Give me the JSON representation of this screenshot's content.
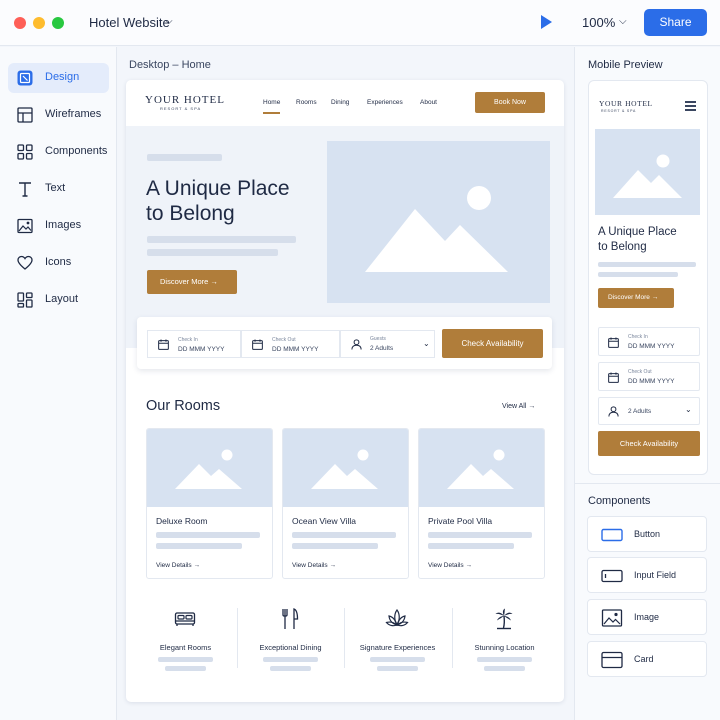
{
  "titlebar": {
    "app_title": "Hotel Website",
    "zoom": "100%",
    "share_label": "Share"
  },
  "sidebar": {
    "items": [
      {
        "label": "Design",
        "icon": "design-icon"
      },
      {
        "label": "Wireframes",
        "icon": "wireframes-icon"
      },
      {
        "label": "Components",
        "icon": "components-icon"
      },
      {
        "label": "Text",
        "icon": "text-icon"
      },
      {
        "label": "Images",
        "icon": "images-icon"
      },
      {
        "label": "Icons",
        "icon": "heart-icon"
      },
      {
        "label": "Layout",
        "icon": "layout-icon"
      }
    ],
    "active": "Design"
  },
  "canvas": {
    "label": "Desktop – Home",
    "header": {
      "logo": "YOUR HOTEL",
      "logo_sub": "RESORT & SPA",
      "nav": [
        "Home",
        "Rooms",
        "Dining",
        "Experiences",
        "About"
      ],
      "active_nav": "Home",
      "book_label": "Book Now"
    },
    "hero": {
      "title_line1": "A Unique Place",
      "title_line2": "to Belong",
      "cta": "Discover More →"
    },
    "booking": {
      "check_in_label": "Check In",
      "check_in_value": "DD MMM YYYY",
      "check_out_label": "Check Out",
      "check_out_value": "DD MMM YYYY",
      "guests_label": "Guests",
      "guests_value": "2 Adults",
      "button": "Check Availability"
    },
    "rooms": {
      "title": "Our Rooms",
      "view_all": "View All",
      "cards": [
        {
          "name": "Deluxe Room",
          "link": "View Details →"
        },
        {
          "name": "Ocean View Villa",
          "link": "View Details →"
        },
        {
          "name": "Private Pool Villa",
          "link": "View Details →"
        }
      ]
    },
    "features": [
      {
        "label": "Elegant Rooms",
        "icon": "bed-icon"
      },
      {
        "label": "Exceptional Dining",
        "icon": "dining-icon"
      },
      {
        "label": "Signature Experiences",
        "icon": "lotus-icon"
      },
      {
        "label": "Stunning Location",
        "icon": "palm-tree-icon"
      }
    ]
  },
  "mobile": {
    "label": "Mobile Preview",
    "logo": "YOUR HOTEL",
    "logo_sub": "RESORT & SPA",
    "title_line1": "A Unique Place",
    "title_line2": "to Belong",
    "cta": "Discover More →",
    "check_in_label": "Check In",
    "check_in_value": "DD MMM YYYY",
    "check_out_label": "Check Out",
    "check_out_value": "DD MMM YYYY",
    "guests_value": "2 Adults",
    "button": "Check Availability"
  },
  "components": {
    "title": "Components",
    "items": [
      {
        "label": "Button",
        "icon": "button-icon"
      },
      {
        "label": "Input Field",
        "icon": "input-field-icon"
      },
      {
        "label": "Image",
        "icon": "image-icon"
      },
      {
        "label": "Card",
        "icon": "card-icon"
      }
    ]
  },
  "colors": {
    "accent": "#2b6de8",
    "brand_gold": "#b07d3a",
    "placeholder": "#d7e2f1",
    "text": "#1f2a44"
  }
}
